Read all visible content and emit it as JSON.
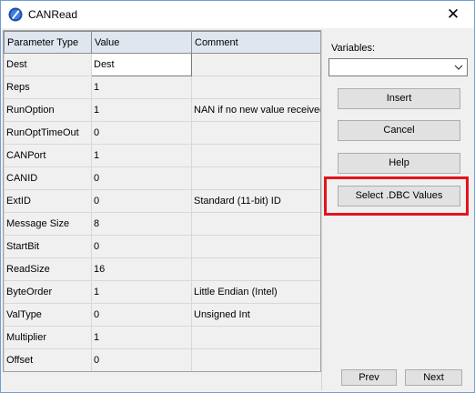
{
  "window": {
    "title": "CANRead",
    "close_glyph": "✕"
  },
  "table": {
    "columns": [
      "Parameter Type",
      "Value",
      "Comment"
    ],
    "rows": [
      {
        "param": "Dest",
        "value": "Dest",
        "comment": ""
      },
      {
        "param": "Reps",
        "value": "1",
        "comment": ""
      },
      {
        "param": "RunOption",
        "value": "1",
        "comment": "NAN if no new value received"
      },
      {
        "param": "RunOptTimeOut",
        "value": "0",
        "comment": ""
      },
      {
        "param": "CANPort",
        "value": "1",
        "comment": ""
      },
      {
        "param": "CANID",
        "value": "0",
        "comment": ""
      },
      {
        "param": "ExtID",
        "value": "0",
        "comment": "Standard (11-bit) ID"
      },
      {
        "param": "Message Size",
        "value": "8",
        "comment": ""
      },
      {
        "param": "StartBit",
        "value": "0",
        "comment": ""
      },
      {
        "param": "ReadSize",
        "value": "16",
        "comment": ""
      },
      {
        "param": "ByteOrder",
        "value": "1",
        "comment": "Little Endian (Intel)"
      },
      {
        "param": "ValType",
        "value": "0",
        "comment": "Unsigned Int"
      },
      {
        "param": "Multiplier",
        "value": "1",
        "comment": ""
      },
      {
        "param": "Offset",
        "value": "0",
        "comment": ""
      }
    ]
  },
  "variables": {
    "label": "Variables:",
    "selected": ""
  },
  "buttons": {
    "insert": "Insert",
    "cancel": "Cancel",
    "help": "Help",
    "select_dbc": "Select .DBC Values",
    "prev": "Prev",
    "next": "Next"
  },
  "icons": {
    "app": "crnr-logo-icon",
    "dropdown": "chevron-down-icon",
    "close": "close-icon"
  },
  "colors": {
    "highlight": "#e3131b",
    "header_bg": "#dfe6ef",
    "window_border": "#6f9fd6"
  }
}
